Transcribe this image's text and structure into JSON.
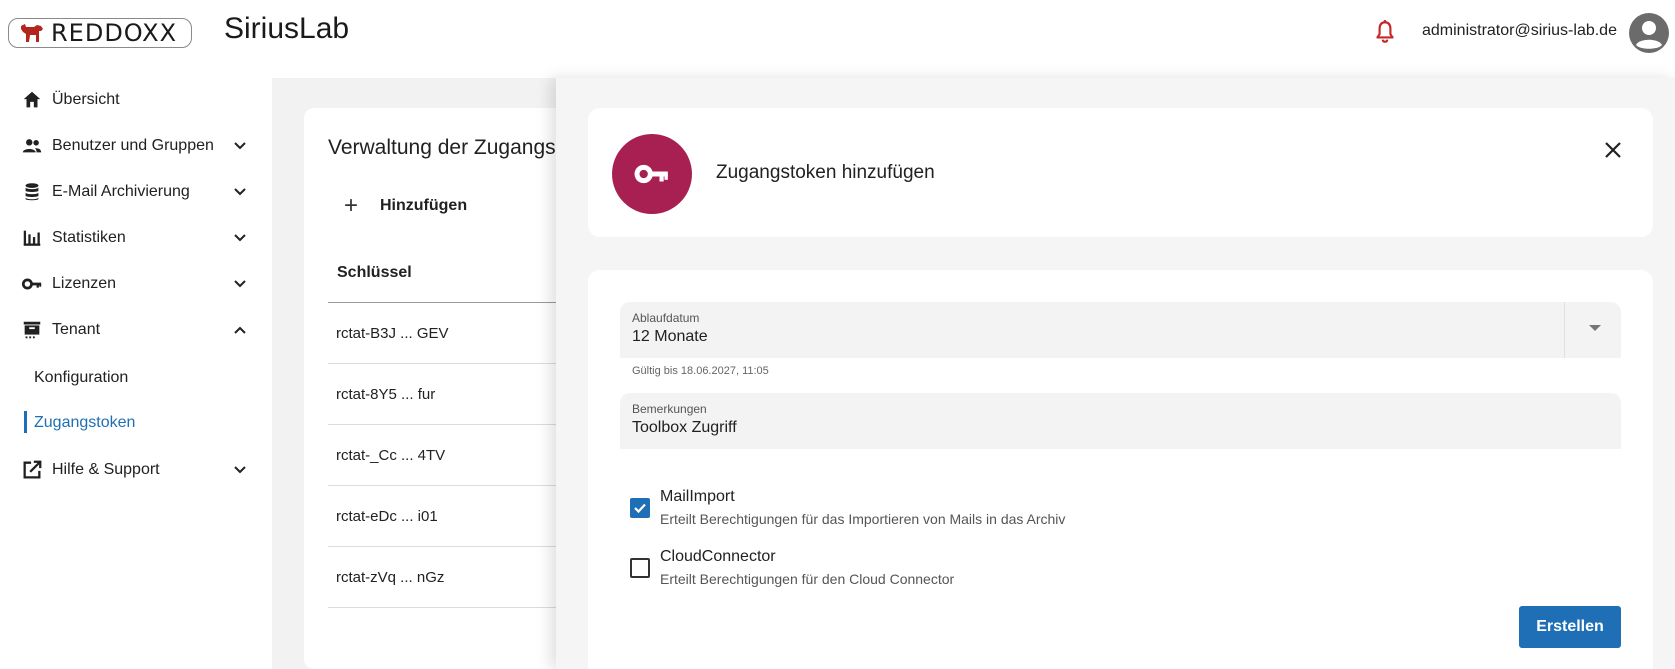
{
  "header": {
    "logo_text": "REDDOXX",
    "app_title": "SiriusLab",
    "user_email": "administrator@sirius-lab.de"
  },
  "sidebar": {
    "items": [
      {
        "label": "Übersicht",
        "icon": "home-icon"
      },
      {
        "label": "Benutzer und Gruppen",
        "icon": "people-icon"
      },
      {
        "label": "E-Mail Archivierung",
        "icon": "database-icon"
      },
      {
        "label": "Statistiken",
        "icon": "bar-chart-icon"
      },
      {
        "label": "Lizenzen",
        "icon": "key-icon"
      },
      {
        "label": "Tenant",
        "icon": "tenant-icon"
      },
      {
        "label": "Hilfe & Support",
        "icon": "external-link-icon"
      }
    ],
    "sub_items": [
      {
        "label": "Konfiguration"
      },
      {
        "label": "Zugangstoken"
      }
    ]
  },
  "main": {
    "card_title": "Verwaltung der Zugangs",
    "add_label": "Hinzufügen",
    "table_header": "Schlüssel",
    "rows": [
      "rctat-B3J ... GEV",
      "rctat-8Y5 ... fur",
      "rctat-_Cc ... 4TV",
      "rctat-eDc ... i01",
      "rctat-zVq ... nGz"
    ]
  },
  "dialog": {
    "title": "Zugangstoken hinzufügen",
    "expiry_label": "Ablaufdatum",
    "expiry_value": "12 Monate",
    "expiry_hint": "Gültig bis 18.06.2027, 11:05",
    "remarks_label": "Bemerkungen",
    "remarks_value": "Toolbox Zugriff",
    "permissions": [
      {
        "title": "MailImport",
        "description": "Erteilt Berechtigungen für das Importieren von Mails in das Archiv",
        "checked": true
      },
      {
        "title": "CloudConnector",
        "description": "Erteilt Berechtigungen für den Cloud Connector",
        "checked": false
      }
    ],
    "create_label": "Erstellen"
  },
  "colors": {
    "accent": "#1e6fb5",
    "brand": "#a81f52",
    "bell": "#c62828"
  }
}
